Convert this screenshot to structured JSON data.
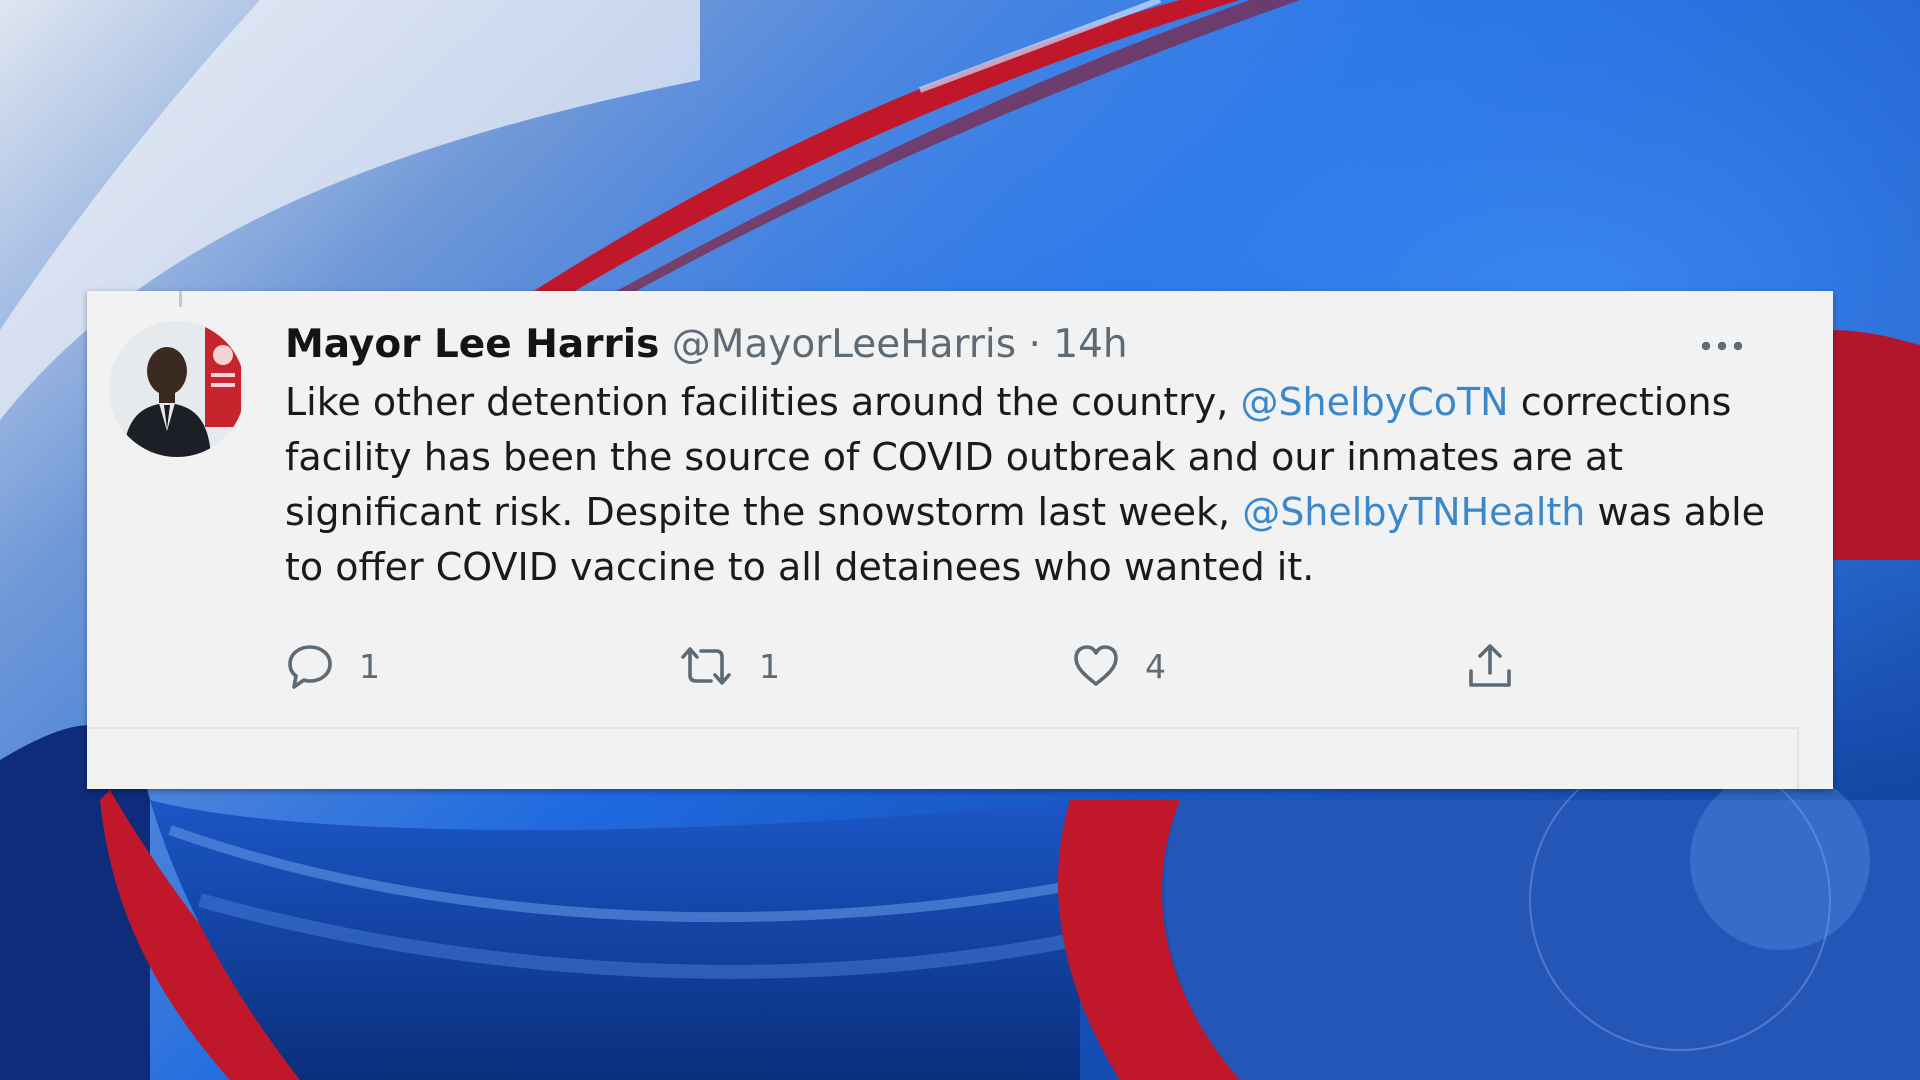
{
  "tweet": {
    "display_name": "Mayor Lee Harris",
    "handle": "@MayorLeeHarris",
    "separator": "·",
    "time": "14h",
    "more_icon": "more-horizontal-icon",
    "text": {
      "part1": "Like other detention facilities around the country, ",
      "mention1": "@ShelbyCoTN",
      "part2": " corrections facility has been the source of COVID outbreak and our inmates are at significant risk. Despite the snowstorm last week, ",
      "mention2": "@ShelbyTNHealth",
      "part3": " was able to offer COVID vaccine to all detainees who wanted it."
    },
    "actions": {
      "reply": {
        "icon": "reply-icon",
        "count": "1"
      },
      "retweet": {
        "icon": "retweet-icon",
        "count": "1"
      },
      "like": {
        "icon": "heart-icon",
        "count": "4"
      },
      "share": {
        "icon": "share-icon"
      }
    }
  },
  "colors": {
    "mention": "#3a88c9",
    "card_bg": "#f2f2f2",
    "secondary_text": "#5e6a74",
    "background_blue": "#1a4fb8",
    "background_red": "#c0182a"
  }
}
